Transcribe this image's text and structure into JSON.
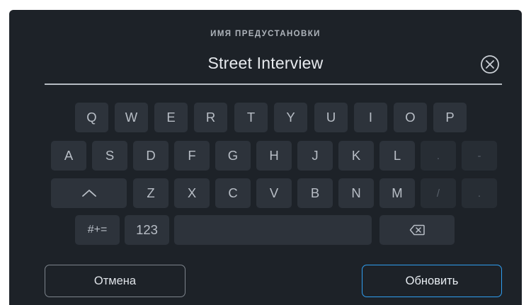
{
  "field": {
    "label": "ИМЯ ПРЕДУСТАНОВКИ",
    "value": "Street Interview",
    "clear_icon": "close-circle-icon"
  },
  "keyboard": {
    "row1": [
      "Q",
      "W",
      "E",
      "R",
      "T",
      "Y",
      "U",
      "I",
      "O",
      "P"
    ],
    "row2": [
      "A",
      "S",
      "D",
      "F",
      "G",
      "H",
      "J",
      "K",
      "L",
      ".",
      "-"
    ],
    "row3": [
      "Z",
      "X",
      "C",
      "V",
      "B",
      "N",
      "M",
      "/",
      "."
    ],
    "shift_icon": "chevron-up-icon",
    "symbols_label": "#+=",
    "numbers_label": "123",
    "backspace_icon": "backspace-icon"
  },
  "buttons": {
    "cancel_label": "Отмена",
    "update_label": "Обновить"
  },
  "colors": {
    "background": "#1d2228",
    "key": "#2d333b",
    "accent": "#2f9ef0"
  }
}
